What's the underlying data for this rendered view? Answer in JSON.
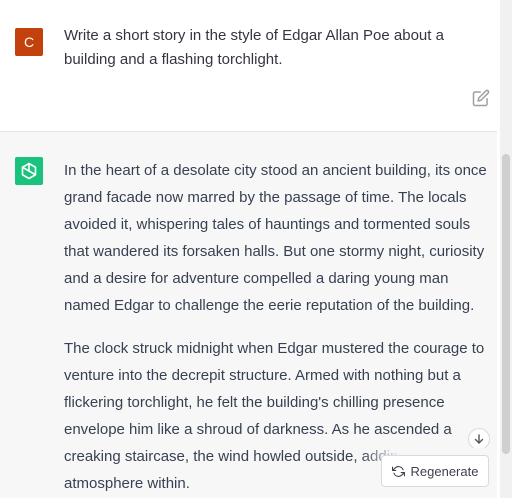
{
  "user_message": {
    "avatar_letter": "C",
    "text": "Write a short story in the style of Edgar Allan Poe about a building and a flashing torchlight.",
    "edit_icon": "edit-icon"
  },
  "assistant_message": {
    "avatar_icon": "openai-logo-icon",
    "paragraphs": [
      "In the heart of a desolate city stood an ancient building, its once grand facade now marred by the passage of time. The locals avoided it, whispering tales of hauntings and tormented souls that wandered its forsaken halls. But one stormy night, curiosity and a desire for adventure compelled a daring young man named Edgar to challenge the eerie reputation of the building.",
      "The clock struck midnight when Edgar mustered the courage to venture into the decrepit structure. Armed with nothing but a flickering torchlight, he felt the building's chilling presence envelope him like a shroud of darkness. As he ascended a creaking staircase, the wind howled outside, adding to the eerie atmosphere within."
    ]
  },
  "controls": {
    "regenerate_label": "Regenerate",
    "regenerate_icon": "refresh-icon",
    "scroll_down_icon": "arrow-down-icon"
  },
  "colors": {
    "user_avatar": "#c2410c",
    "assistant_avatar": "#19c37d",
    "assistant_background": "#f7f7f8"
  }
}
